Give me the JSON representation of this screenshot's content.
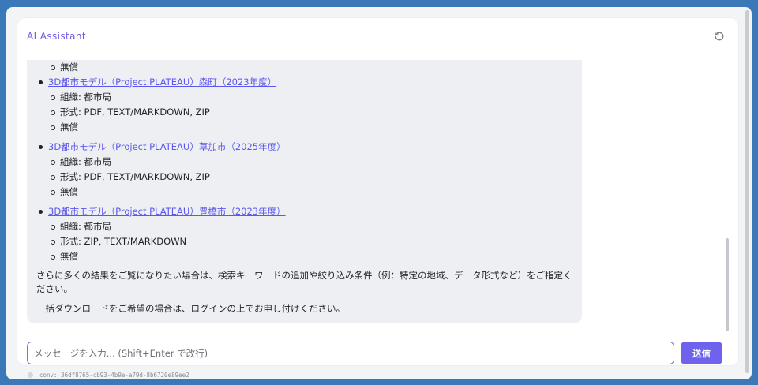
{
  "header": {
    "title": "AI Assistant",
    "refresh_icon": "refresh-icon"
  },
  "message": {
    "leading_sub_item": "無償",
    "results": [
      {
        "title": "3D都市モデル（Project PLATEAU）森町（2023年度）",
        "organization": "組織: 都市局",
        "format": "形式: PDF, TEXT/MARKDOWN, ZIP",
        "price": "無償"
      },
      {
        "title": "3D都市モデル（Project PLATEAU）草加市（2025年度）",
        "organization": "組織: 都市局",
        "format": "形式: PDF, TEXT/MARKDOWN, ZIP",
        "price": "無償"
      },
      {
        "title": "3D都市モデル（Project PLATEAU）豊橋市（2023年度）",
        "organization": "組織: 都市局",
        "format": "形式: ZIP, TEXT/MARKDOWN",
        "price": "無償"
      }
    ],
    "paragraph_1": "さらに多くの結果をご覧になりたい場合は、検索キーワードの追加や絞り込み条件（例：特定の地域、データ形式など）をご指定ください。",
    "paragraph_2": "一括ダウンロードをご希望の場合は、ログインの上でお申し付けください。"
  },
  "composer": {
    "placeholder": "メッセージを入力... (Shift+Enter で改行)",
    "value": "",
    "send_label": "送信"
  },
  "footer": {
    "conversation_id": "conv: 36df8765-cb93-4b9e-a79d-8b6720e89ee2"
  },
  "colors": {
    "accent": "#6f63ee",
    "link": "#5b57f0",
    "bubble_bg": "#eeeff2"
  }
}
